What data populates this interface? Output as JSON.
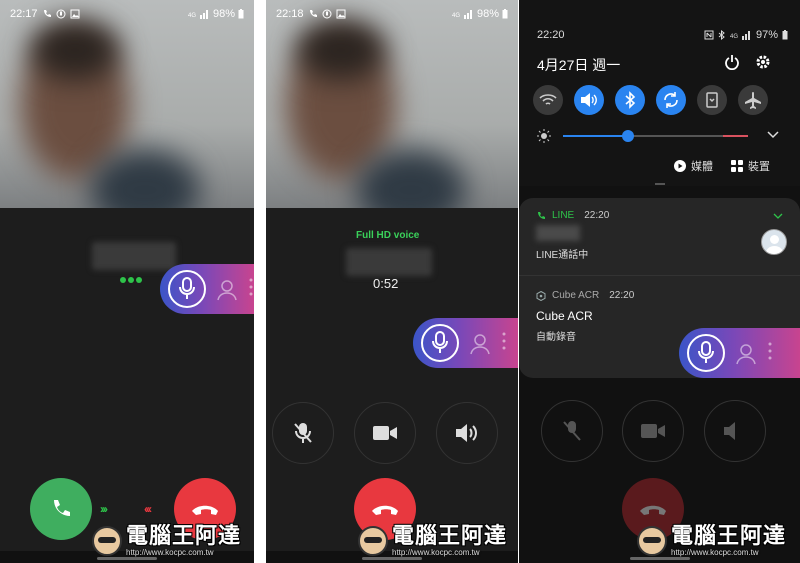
{
  "panels": [
    {
      "status": {
        "time": "22:17",
        "battery": "98%"
      },
      "state": "incoming",
      "buttons": {
        "accept": "phone-icon",
        "decline": "phone-hangup-icon"
      }
    },
    {
      "status": {
        "time": "22:18",
        "battery": "98%"
      },
      "state": "in-call",
      "hd_label": "Full HD voice",
      "timer": "0:52",
      "controls": [
        "mute",
        "video",
        "speaker"
      ]
    },
    {
      "status": {
        "time": "22:20",
        "battery": "97%"
      },
      "state": "notification-shade",
      "date": "4月27日 週一",
      "quick_tiles": [
        {
          "icon": "wifi-icon",
          "on": false
        },
        {
          "icon": "volume-icon",
          "on": true
        },
        {
          "icon": "bluetooth-icon",
          "on": true
        },
        {
          "icon": "sync-icon",
          "on": true
        },
        {
          "icon": "portrait-icon",
          "on": false
        },
        {
          "icon": "airplane-icon",
          "on": false
        }
      ],
      "brightness": 0.35,
      "media_label": "媒體",
      "device_label": "裝置",
      "notifications": [
        {
          "app": "LINE",
          "time": "22:20",
          "body": "LINE通話中",
          "color": "#2ec34a"
        },
        {
          "app": "Cube ACR",
          "time": "22:20",
          "title": "Cube ACR",
          "body": "自動錄音",
          "color": "#9aa"
        }
      ]
    }
  ],
  "watermark": {
    "title": "電腦王阿達",
    "url": "http://www.kocpc.com.tw"
  }
}
